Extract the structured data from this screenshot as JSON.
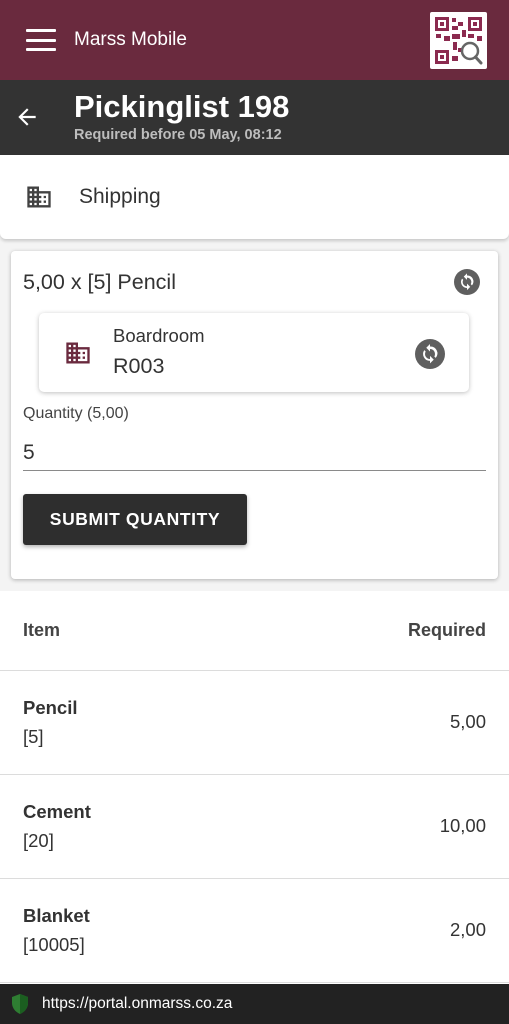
{
  "app_bar": {
    "title": "Marss Mobile",
    "menu_icon": "menu-icon",
    "qr_icon": "qr-search-icon"
  },
  "header": {
    "title": "Pickinglist 198",
    "subtitle": "Required before 05 May, 08:12",
    "back_icon": "arrow-back-icon"
  },
  "shipping": {
    "label": "Shipping",
    "icon": "building-icon"
  },
  "task": {
    "title": "5,00 x [5] Pencil",
    "location": {
      "name": "Boardroom",
      "code": "R003",
      "icon": "building-icon"
    },
    "quantity_label": "Quantity (5,00)",
    "quantity_value": "5",
    "submit_label": "SUBMIT QUANTITY"
  },
  "table": {
    "headers": {
      "item": "Item",
      "required": "Required"
    },
    "rows": [
      {
        "name": "Pencil",
        "code": "[5]",
        "required": "5,00"
      },
      {
        "name": "Cement",
        "code": "[20]",
        "required": "10,00"
      },
      {
        "name": "Blanket",
        "code": "[10005]",
        "required": "2,00"
      }
    ]
  },
  "browser": {
    "url": "https://portal.onmarss.co.za"
  },
  "colors": {
    "primary": "#6a2a3e",
    "header": "#333333",
    "button": "#2e2e2e",
    "secure": "#2e7d32"
  }
}
